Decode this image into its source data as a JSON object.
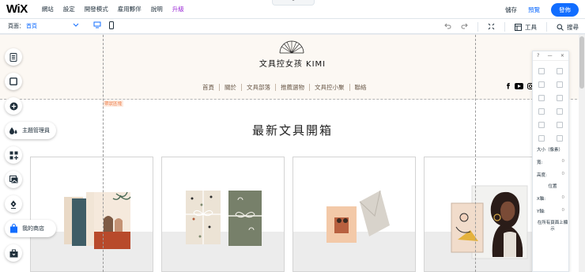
{
  "topbar": {
    "logo": "WiX",
    "menu": [
      "網站",
      "設定",
      "開發模式",
      "雇用夥伴",
      "說明",
      "升級"
    ],
    "collapse_glyph": "⌃",
    "save_label": "儲存",
    "preview_label": "預覽",
    "publish_label": "發佈"
  },
  "secondbar": {
    "page_label": "頁面：",
    "page_value": "首頁",
    "tools_label": "工具",
    "search_label": "搜尋"
  },
  "site": {
    "brand": "文具控女孩 KIMI",
    "nav": [
      "首頁",
      "關於",
      "文具部落",
      "推薦選物",
      "文具控小聚",
      "聯絡"
    ],
    "strip_label": "帶狀區塊",
    "section_title": "最新文具開箱"
  },
  "leftbar": {
    "theme_label": "主題管理員",
    "store_label": "我的商店"
  },
  "rpanel": {
    "header_help": "?",
    "header_close": "×",
    "size_label": "大小（像素）",
    "width_label": "寬:",
    "height_label": "高度:",
    "position_label": "位置",
    "x_label": "X軸:",
    "y_label": "Y軸:",
    "pages_label": "在所有頁面上顯示",
    "value_placeholder": "0"
  },
  "colors": {
    "accent": "#116dff",
    "upgrade": "#9a27d5",
    "header_bg": "#fcf8f3"
  }
}
